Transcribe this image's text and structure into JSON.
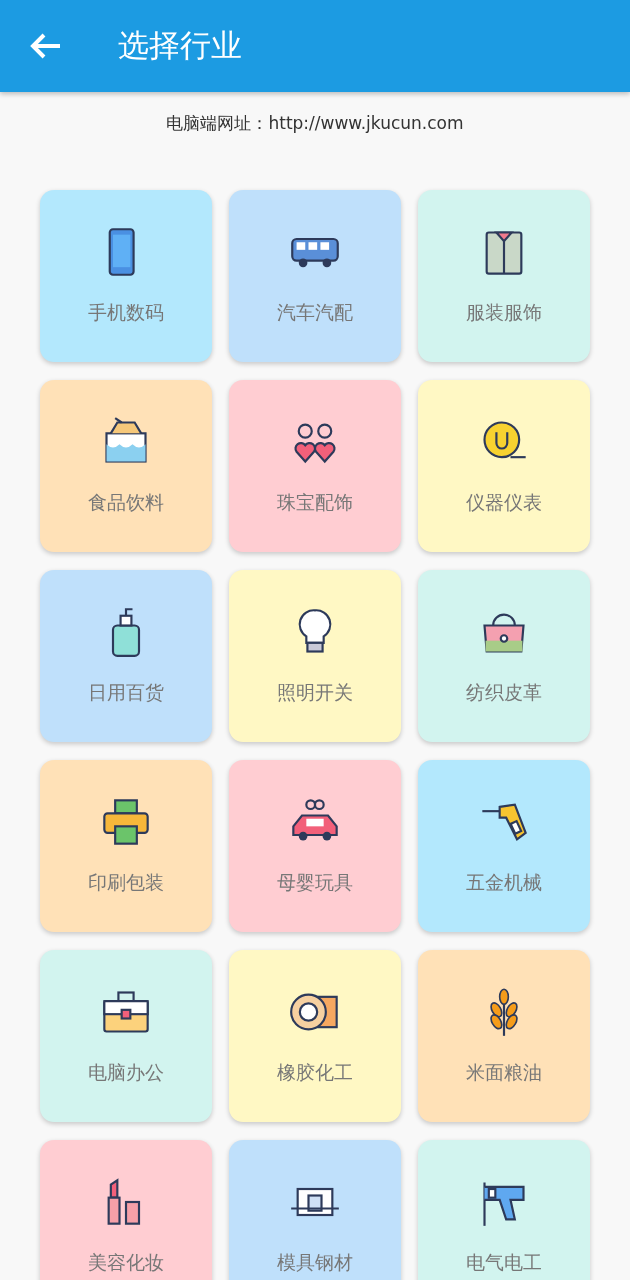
{
  "header": {
    "title": "选择行业"
  },
  "site_note": "电脑端网址：http://www.jkucun.com",
  "industries": [
    {
      "label": "手机数码",
      "color": "#b3e8fd"
    },
    {
      "label": "汽车汽配",
      "color": "#bfe0fb"
    },
    {
      "label": "服装服饰",
      "color": "#d2f4ef"
    },
    {
      "label": "食品饮料",
      "color": "#ffe1b7"
    },
    {
      "label": "珠宝配饰",
      "color": "#ffcdd2"
    },
    {
      "label": "仪器仪表",
      "color": "#fff8c4"
    },
    {
      "label": "日用百货",
      "color": "#bfe0fb"
    },
    {
      "label": "照明开关",
      "color": "#fff8c4"
    },
    {
      "label": "纺织皮革",
      "color": "#d2f4ef"
    },
    {
      "label": "印刷包装",
      "color": "#ffe1b7"
    },
    {
      "label": "母婴玩具",
      "color": "#ffcdd2"
    },
    {
      "label": "五金机械",
      "color": "#b3e8fd"
    },
    {
      "label": "电脑办公",
      "color": "#d2f4ef"
    },
    {
      "label": "橡胶化工",
      "color": "#fff8c4"
    },
    {
      "label": "米面粮油",
      "color": "#ffe1b7"
    },
    {
      "label": "美容化妆",
      "color": "#ffcdd2"
    },
    {
      "label": "模具钢材",
      "color": "#bfe0fb"
    },
    {
      "label": "电气电工",
      "color": "#d2f4ef"
    }
  ]
}
